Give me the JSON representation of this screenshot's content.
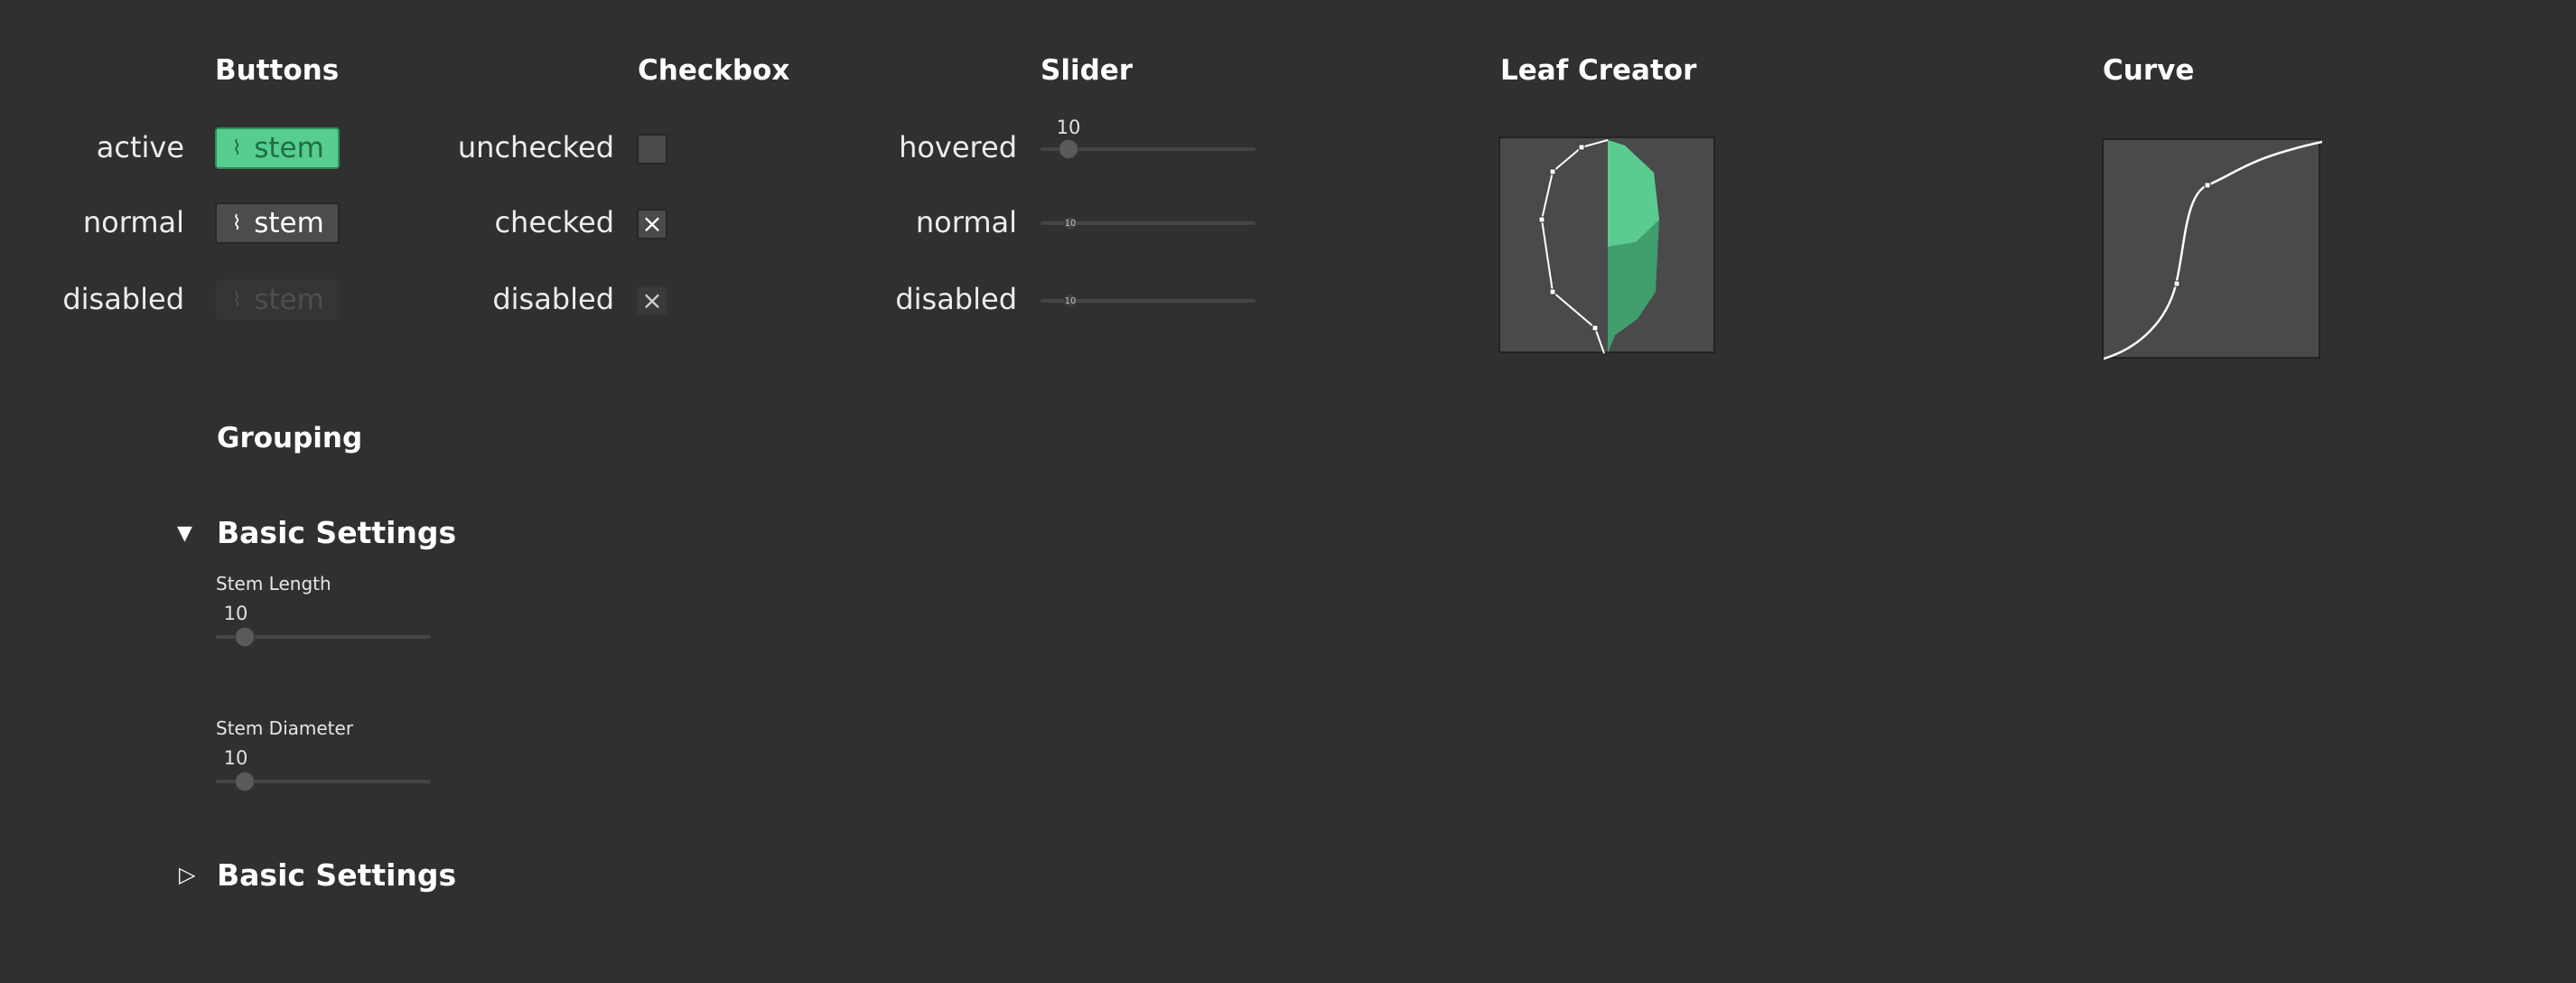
{
  "headings": {
    "buttons": "Buttons",
    "checkbox": "Checkbox",
    "slider": "Slider",
    "leaf_creator": "Leaf Creator",
    "curve": "Curve",
    "grouping": "Grouping"
  },
  "buttons": {
    "rows": [
      {
        "state": "active",
        "label": "stem",
        "icon": "stem-icon"
      },
      {
        "state": "normal",
        "label": "stem",
        "icon": "stem-icon"
      },
      {
        "state": "disabled",
        "label": "stem",
        "icon": "stem-icon"
      }
    ],
    "icon_glyph": "⌇"
  },
  "checkbox": {
    "rows": [
      {
        "state": "unchecked",
        "mark": ""
      },
      {
        "state": "checked",
        "mark": "×"
      },
      {
        "state": "disabled",
        "mark": "×"
      }
    ]
  },
  "slider": {
    "rows": [
      {
        "state": "hovered",
        "value": "10"
      },
      {
        "state": "normal",
        "value": "10"
      },
      {
        "state": "disabled",
        "value": "10"
      }
    ]
  },
  "grouping": {
    "expanded_group": {
      "title": "Basic Settings",
      "toggle_glyph": "▼",
      "fields": [
        {
          "label": "Stem Length",
          "value": "10"
        },
        {
          "label": "Stem Diameter",
          "value": "10"
        }
      ]
    },
    "collapsed_group": {
      "title": "Basic Settings",
      "toggle_glyph": "▷"
    }
  },
  "colors": {
    "background": "#303030",
    "accent_green": "#57cd8f",
    "leaf_dark_green": "#2e8b57",
    "panel": "#4a4a4a"
  }
}
